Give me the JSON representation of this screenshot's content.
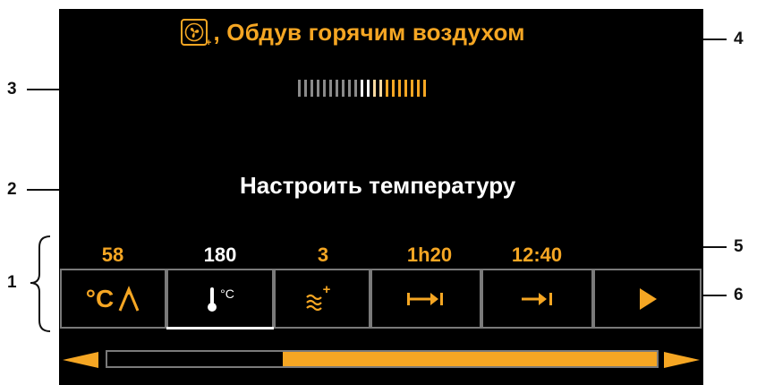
{
  "header": {
    "mode_title": ", Обдув горячим воздухом",
    "fan_icon": "fan-hot-air-icon",
    "plus_glyph": "+"
  },
  "level_indicator": {
    "total_segments": 21,
    "active_segments": 11,
    "inactive_color": "#8a8a8a",
    "active_color": "#ffffff",
    "highlight_color": "#f5a623"
  },
  "prompt": {
    "text": "Настроить температуру"
  },
  "values": {
    "core_temp": "58",
    "oven_temp": "180",
    "humidity_level": "3",
    "duration": "1h20",
    "end_time": "12:40"
  },
  "buttons": {
    "core_temp_label": "°C",
    "oven_temp_label": "°C",
    "humidity_plus": "+"
  },
  "progress": {
    "filled_fraction": 0.68
  },
  "callouts": {
    "n1": "1",
    "n2": "2",
    "n3": "3",
    "n4": "4",
    "n5": "5",
    "n6": "6"
  },
  "colors": {
    "accent": "#f5a623",
    "background": "#000000",
    "frame": "#7a7a7a",
    "text": "#ffffff"
  }
}
